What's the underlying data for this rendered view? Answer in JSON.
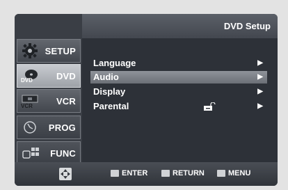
{
  "header": {
    "title": "DVD Setup"
  },
  "sidebar": {
    "items": [
      {
        "label": "SETUP",
        "icon": "gear-icon"
      },
      {
        "label": "DVD",
        "icon": "dvd-disc-icon",
        "sublabel": "DVD"
      },
      {
        "label": "VCR",
        "icon": "vcr-icon",
        "sublabel": "VCR"
      },
      {
        "label": "PROG",
        "icon": "clock-icon"
      },
      {
        "label": "FUNC",
        "icon": "func-icon"
      }
    ]
  },
  "menu": {
    "items": [
      {
        "label": "Language",
        "arrow": "▶"
      },
      {
        "label": "Audio",
        "arrow": "▶"
      },
      {
        "label": "Display",
        "arrow": "▶"
      },
      {
        "label": "Parental",
        "arrow": "▶"
      }
    ],
    "selected": "Audio"
  },
  "footer": {
    "enter": "ENTER",
    "return": "RETURN",
    "menu": "MENU"
  }
}
